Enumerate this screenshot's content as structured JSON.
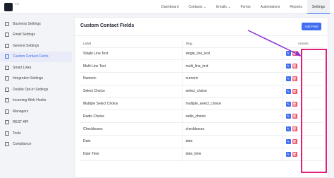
{
  "topbar": {
    "logo_badge": "Pro",
    "nav": [
      "Dashboard",
      "Contacts",
      "Emails",
      "Forms",
      "Automations",
      "Reports",
      "Settings"
    ],
    "active": "Settings"
  },
  "sidebar": {
    "items": [
      {
        "label": "Business Settings",
        "icon": "building-icon"
      },
      {
        "label": "Email Settings",
        "icon": "envelope-icon"
      },
      {
        "label": "General Settings",
        "icon": "gear-icon"
      },
      {
        "label": "Custom Contact Fields",
        "icon": "user-icon"
      },
      {
        "label": "Smart Links",
        "icon": "link-icon"
      },
      {
        "label": "Integration Settings",
        "icon": "plug-icon"
      },
      {
        "label": "Double Opt-in Settings",
        "icon": "check-icon"
      },
      {
        "label": "Incoming Web Hooks",
        "icon": "hook-icon"
      },
      {
        "label": "Managers",
        "icon": "users-icon"
      },
      {
        "label": "REST API",
        "icon": "api-icon"
      },
      {
        "label": "Tools",
        "icon": "wrench-icon"
      },
      {
        "label": "Compliance",
        "icon": "shield-icon"
      }
    ],
    "active_index": 3
  },
  "panel": {
    "title": "Custom Contact Fields",
    "add_button": "Add Field",
    "columns": {
      "label": "Label",
      "slug": "Slug",
      "actions": "Actions"
    },
    "rows": [
      {
        "label": "Single Line Text",
        "slug": "single_line_text"
      },
      {
        "label": "Multi Line Text",
        "slug": "multi_line_text"
      },
      {
        "label": "Numeric",
        "slug": "numeric"
      },
      {
        "label": "Select Choice",
        "slug": "select_choice"
      },
      {
        "label": "Multiple Select Choice",
        "slug": "multiple_select_choice"
      },
      {
        "label": "Radio Choice",
        "slug": "radio_choice"
      },
      {
        "label": "Checkboxes",
        "slug": "checkboxes"
      },
      {
        "label": "Date",
        "slug": "date"
      },
      {
        "label": "Date Time",
        "slug": "date_time"
      }
    ]
  },
  "colors": {
    "accent": "#3f6ef0",
    "danger": "#f0566b",
    "annotation": "#e0207a",
    "arrow": "#8b2fd6"
  }
}
